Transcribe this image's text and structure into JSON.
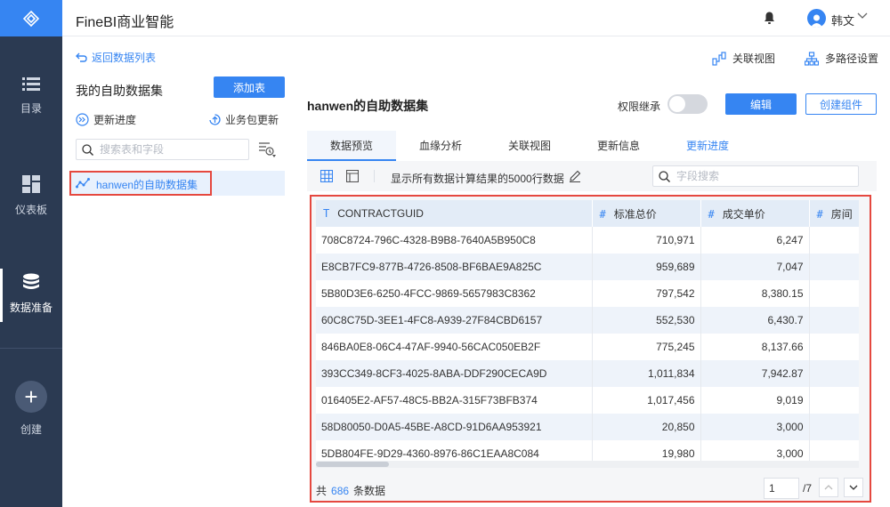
{
  "header": {
    "app_title": "FineBI商业智能",
    "user_name": "韩文"
  },
  "nav": {
    "items": [
      {
        "label": "目录",
        "icon": "list-icon"
      },
      {
        "label": "仪表板",
        "icon": "dashboard-icon"
      },
      {
        "label": "数据准备",
        "icon": "database-icon",
        "active": true
      },
      {
        "label": "创建",
        "icon": "plus-icon"
      }
    ]
  },
  "left_panel": {
    "back_link": "返回数据列表",
    "title": "我的自助数据集",
    "add_table": "添加表",
    "update_progress": "更新进度",
    "package_update": "业务包更新",
    "search_placeholder": "搜索表和字段",
    "dataset_item": "hanwen的自助数据集"
  },
  "top_actions": {
    "relation_view": "关联视图",
    "multipath": "多路径设置"
  },
  "card": {
    "title": "hanwen的自助数据集",
    "perm_inherit": "权限继承",
    "edit": "编辑",
    "create_component": "创建组件",
    "tabs": [
      {
        "label": "数据预览",
        "active": true
      },
      {
        "label": "血缘分析"
      },
      {
        "label": "关联视图"
      },
      {
        "label": "更新信息"
      },
      {
        "label": "更新进度",
        "link": true
      }
    ],
    "info_text": "显示所有数据计算结果的5000行数据",
    "field_search_placeholder": "字段搜索"
  },
  "table": {
    "columns": [
      {
        "type": "T",
        "name": "CONTRACTGUID"
      },
      {
        "type": "#",
        "name": "标准总价"
      },
      {
        "type": "#",
        "name": "成交单价"
      },
      {
        "type": "#",
        "name": "房间"
      }
    ],
    "rows": [
      [
        "708C8724-796C-4328-B9B8-7640A5B950C8",
        "710,971",
        "6,247",
        ""
      ],
      [
        "E8CB7FC9-877B-4726-8508-BF6BAE9A825C",
        "959,689",
        "7,047",
        ""
      ],
      [
        "5B80D3E6-6250-4FCC-9869-5657983C8362",
        "797,542",
        "8,380.15",
        ""
      ],
      [
        "60C8C75D-3EE1-4FC8-A939-27F84CBD6157",
        "552,530",
        "6,430.7",
        ""
      ],
      [
        "846BA0E8-06C4-47AF-9940-56CAC050EB2F",
        "775,245",
        "8,137.66",
        ""
      ],
      [
        "393CC349-8CF3-4025-8ABA-DDF290CECA9D",
        "1,011,834",
        "7,942.87",
        ""
      ],
      [
        "016405E2-AF57-48C5-BB2A-315F73BFB374",
        "1,017,456",
        "9,019",
        ""
      ],
      [
        "58D80050-D0A5-45BE-A8CD-91D6AA953921",
        "20,850",
        "3,000",
        ""
      ],
      [
        "5DB804FE-9D29-4360-8976-86C1EAA8C084",
        "19,980",
        "3,000",
        ""
      ]
    ]
  },
  "footer": {
    "prefix": "共",
    "count": "686",
    "suffix": "条数据",
    "page": "1",
    "total_pages": "/7"
  }
}
